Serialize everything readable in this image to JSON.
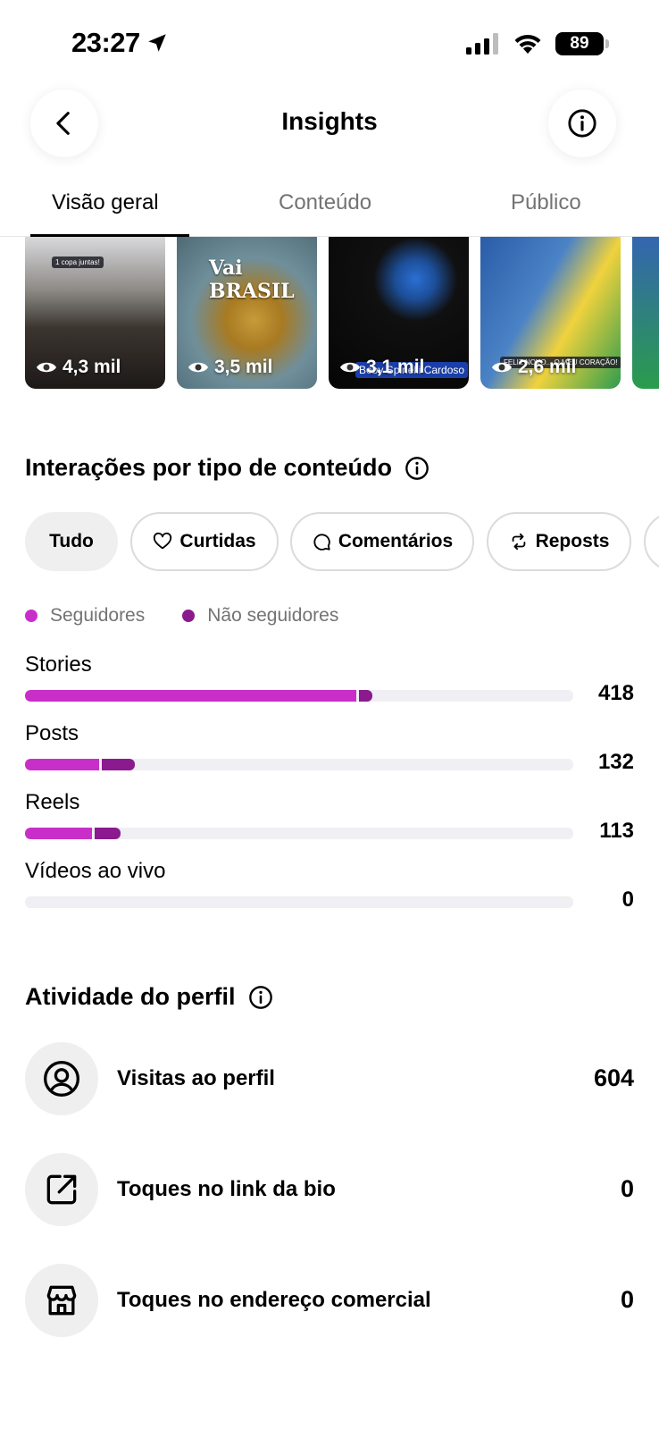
{
  "status_bar": {
    "time": "23:27",
    "battery": "89"
  },
  "header": {
    "title": "Insights"
  },
  "tabs": [
    {
      "label": "Visão geral"
    },
    {
      "label": "Conteúdo"
    },
    {
      "label": "Público"
    }
  ],
  "thumbnails": [
    {
      "views": "4,3 mil",
      "caption": "1 copa juntas!"
    },
    {
      "views": "3,5 mil",
      "caption": "Vai BRASIL"
    },
    {
      "views": "3,1 mil",
      "caption": "Beby Spinelli Cardoso"
    },
    {
      "views": "2,6 mil",
      "caption": "FELIZ NOVO... O MEU CORAÇÃO!"
    }
  ],
  "interactions": {
    "title": "Interações por tipo de conteúdo",
    "chips": [
      {
        "label": "Tudo"
      },
      {
        "label": "Curtidas"
      },
      {
        "label": "Comentários"
      },
      {
        "label": "Reposts"
      }
    ],
    "legend": [
      {
        "label": "Seguidores",
        "color": "#C82FC8"
      },
      {
        "label": "Não seguidores",
        "color": "#8B1A8E"
      }
    ]
  },
  "chart_data": {
    "type": "bar",
    "orientation": "horizontal",
    "stacked": true,
    "categories": [
      "Stories",
      "Posts",
      "Reels",
      "Vídeos ao vivo"
    ],
    "totals": [
      "418",
      "132",
      "113",
      "0"
    ],
    "series": [
      {
        "name": "Seguidores",
        "values": [
          0.605,
          0.135,
          0.122,
          0
        ]
      },
      {
        "name": "Não seguidores",
        "values": [
          0.028,
          0.065,
          0.052,
          0
        ]
      }
    ]
  },
  "profile_activity": {
    "title": "Atividade do perfil",
    "items": [
      {
        "label": "Visitas ao perfil",
        "value": "604",
        "icon": "profile-icon"
      },
      {
        "label": "Toques no link da bio",
        "value": "0",
        "icon": "external-link-icon"
      },
      {
        "label": "Toques no endereço comercial",
        "value": "0",
        "icon": "storefront-icon"
      }
    ]
  }
}
